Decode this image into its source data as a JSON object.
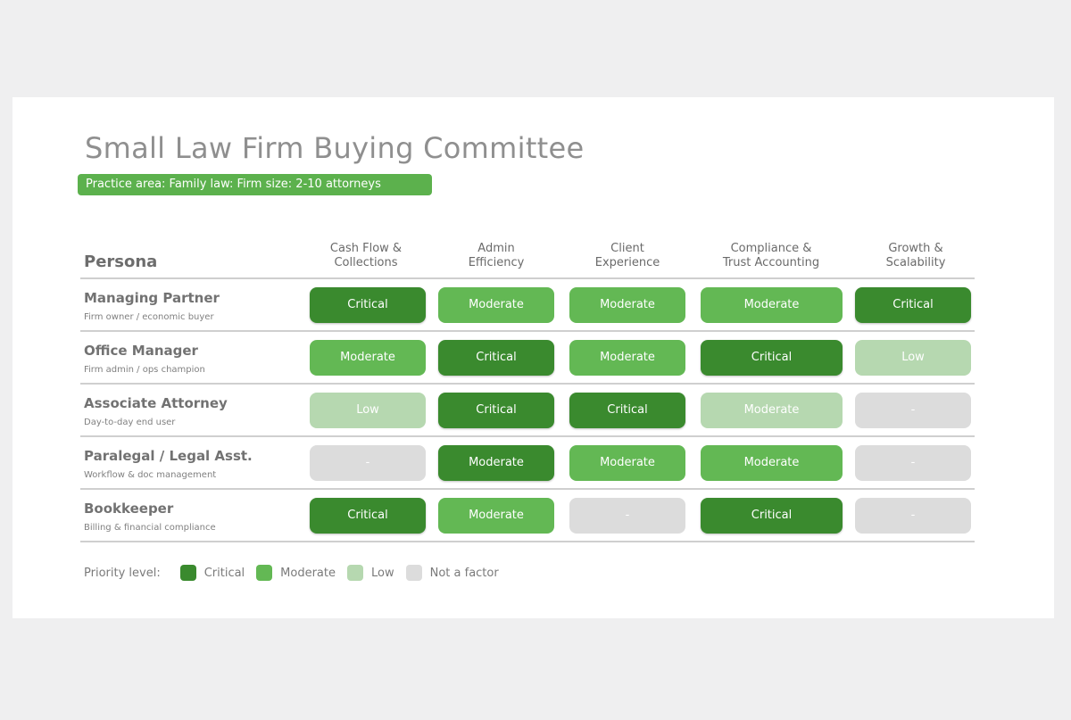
{
  "title": "Small Law Firm Buying Committee",
  "subtitle": "Practice area: Family law: Firm size: 2-10 attorneys",
  "persona_header": "Persona",
  "columns": [
    "Cash Flow &\nCollections",
    "Admin\nEfficiency",
    "Client\nExperience",
    "Compliance &\nTrust Accounting",
    "Growth &\nScalability"
  ],
  "rows": [
    {
      "name": "Managing Partner",
      "desc": "Firm owner / economic buyer",
      "cells": [
        {
          "label": "Critical",
          "level": "critical"
        },
        {
          "label": "Moderate",
          "level": "moderate"
        },
        {
          "label": "Moderate",
          "level": "moderate"
        },
        {
          "label": "Moderate",
          "level": "moderate"
        },
        {
          "label": "Critical",
          "level": "critical"
        }
      ]
    },
    {
      "name": "Office Manager",
      "desc": "Firm admin / ops champion",
      "cells": [
        {
          "label": "Moderate",
          "level": "moderate"
        },
        {
          "label": "Critical",
          "level": "critical"
        },
        {
          "label": "Moderate",
          "level": "moderate"
        },
        {
          "label": "Critical",
          "level": "critical"
        },
        {
          "label": "Low",
          "level": "low"
        }
      ]
    },
    {
      "name": "Associate Attorney",
      "desc": "Day-to-day end user",
      "cells": [
        {
          "label": "Low",
          "level": "low"
        },
        {
          "label": "Critical",
          "level": "critical"
        },
        {
          "label": "Critical",
          "level": "critical"
        },
        {
          "label": "Moderate",
          "level": "low"
        },
        {
          "label": "-",
          "level": "none"
        }
      ]
    },
    {
      "name": "Paralegal / Legal Asst.",
      "desc": "Workflow & doc management",
      "cells": [
        {
          "label": "-",
          "level": "none"
        },
        {
          "label": "Moderate",
          "level": "critical"
        },
        {
          "label": "Moderate",
          "level": "moderate"
        },
        {
          "label": "Moderate",
          "level": "moderate"
        },
        {
          "label": "-",
          "level": "none"
        }
      ]
    },
    {
      "name": "Bookkeeper",
      "desc": "Billing & financial compliance",
      "cells": [
        {
          "label": "Critical",
          "level": "critical"
        },
        {
          "label": "Moderate",
          "level": "moderate"
        },
        {
          "label": "-",
          "level": "none"
        },
        {
          "label": "Critical",
          "level": "critical"
        },
        {
          "label": "-",
          "level": "none"
        }
      ]
    }
  ],
  "legend": {
    "label": "Priority level:",
    "items": [
      {
        "label": "Critical",
        "level": "critical"
      },
      {
        "label": "Moderate",
        "level": "moderate"
      },
      {
        "label": "Low",
        "level": "low"
      },
      {
        "label": "Not a factor",
        "level": "none"
      }
    ]
  },
  "colors": {
    "critical": "#3a8a2e",
    "moderate": "#63b854",
    "low": "#b6d8b0",
    "none": "#dcdcdc",
    "accent": "#5cb14d"
  }
}
